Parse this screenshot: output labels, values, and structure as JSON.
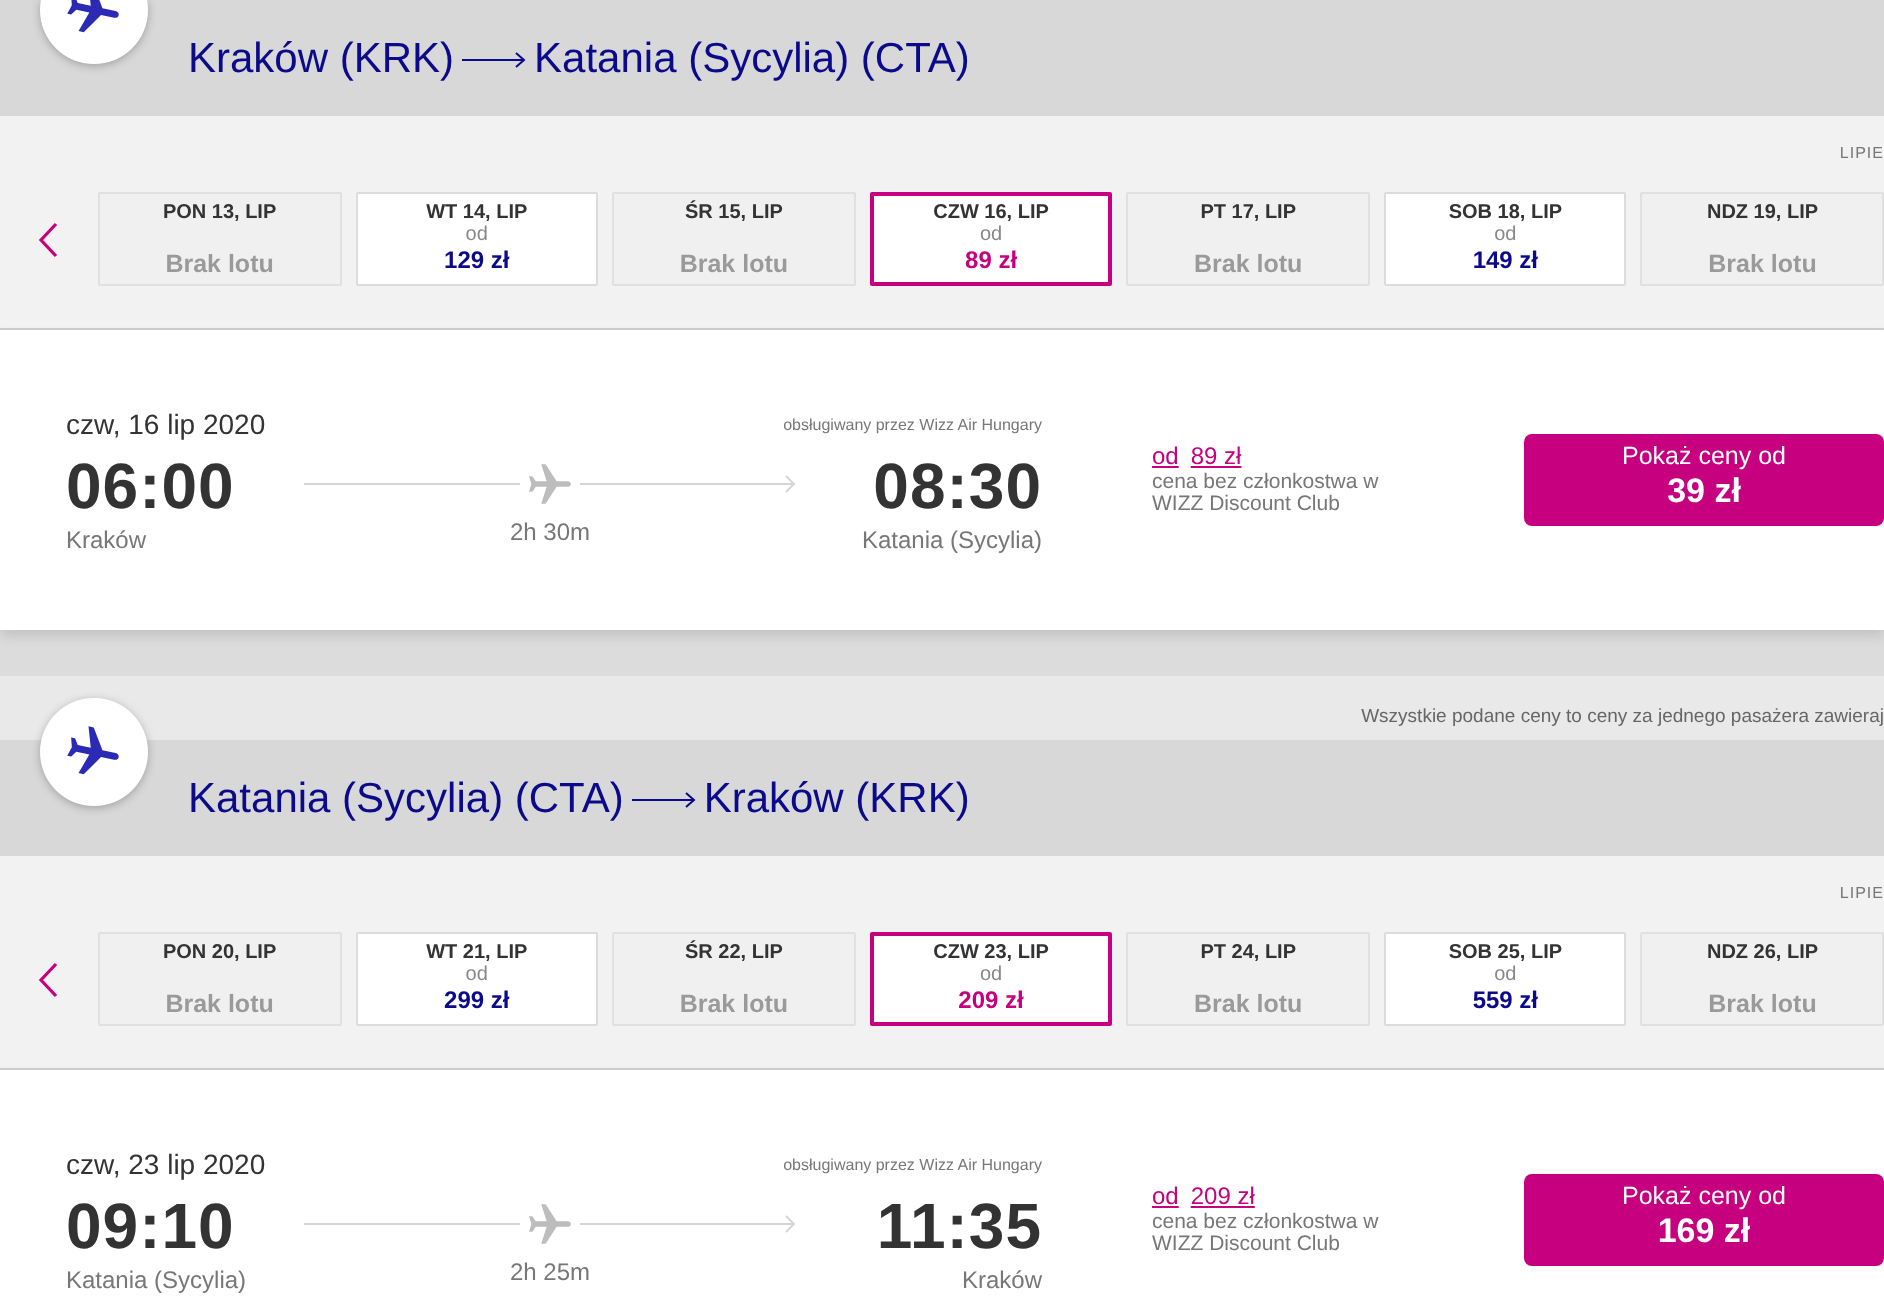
{
  "journeys": [
    {
      "route": {
        "origin": "Kraków (KRK)",
        "destination": "Katania (Sycylia) (CTA)"
      },
      "month_label": "LIPIE",
      "dates": [
        {
          "kind": "no_flight",
          "day": "PON 13, LIP",
          "status": "Brak lotu",
          "selected": false
        },
        {
          "kind": "fare",
          "day": "WT 14, LIP",
          "from": "od",
          "price": "129 zł",
          "selected": false
        },
        {
          "kind": "no_flight",
          "day": "ŚR 15, LIP",
          "status": "Brak lotu",
          "selected": false
        },
        {
          "kind": "fare",
          "day": "CZW 16, LIP",
          "from": "od",
          "price": "89 zł",
          "selected": true
        },
        {
          "kind": "no_flight",
          "day": "PT 17, LIP",
          "status": "Brak lotu",
          "selected": false
        },
        {
          "kind": "fare",
          "day": "SOB 18, LIP",
          "from": "od",
          "price": "149 zł",
          "selected": false
        },
        {
          "kind": "no_flight",
          "day": "NDZ 19, LIP",
          "status": "Brak lotu",
          "selected": false
        }
      ],
      "flight": {
        "date": "czw, 16 lip 2020",
        "operator": "obsługiwany przez Wizz Air Hungary",
        "departure_time": "06:00",
        "departure_city": "Kraków",
        "duration": "2h 30m",
        "arrival_time": "08:30",
        "arrival_city": "Katania (Sycylia)",
        "fare_from": "od",
        "fare_price": "89 zł",
        "fare_note": "cena bez członkostwa w WIZZ Discount Club",
        "button_label": "Pokaż ceny od",
        "button_price": "39 zł"
      }
    },
    {
      "notice": "Wszystkie podane ceny to ceny za jednego pasażera zawieraj",
      "route": {
        "origin": "Katania (Sycylia) (CTA)",
        "destination": "Kraków (KRK)"
      },
      "month_label": "LIPIE",
      "dates": [
        {
          "kind": "no_flight",
          "day": "PON 20, LIP",
          "status": "Brak lotu",
          "selected": false
        },
        {
          "kind": "fare",
          "day": "WT 21, LIP",
          "from": "od",
          "price": "299 zł",
          "selected": false
        },
        {
          "kind": "no_flight",
          "day": "ŚR 22, LIP",
          "status": "Brak lotu",
          "selected": false
        },
        {
          "kind": "fare",
          "day": "CZW 23, LIP",
          "from": "od",
          "price": "209 zł",
          "selected": true
        },
        {
          "kind": "no_flight",
          "day": "PT 24, LIP",
          "status": "Brak lotu",
          "selected": false
        },
        {
          "kind": "fare",
          "day": "SOB 25, LIP",
          "from": "od",
          "price": "559 zł",
          "selected": false
        },
        {
          "kind": "no_flight",
          "day": "NDZ 26, LIP",
          "status": "Brak lotu",
          "selected": false
        }
      ],
      "flight": {
        "date": "czw, 23 lip 2020",
        "operator": "obsługiwany przez Wizz Air Hungary",
        "departure_time": "09:10",
        "departure_city": "Katania (Sycylia)",
        "duration": "2h 25m",
        "arrival_time": "11:35",
        "arrival_city": "Kraków",
        "fare_from": "od",
        "fare_price": "209 zł",
        "fare_note": "cena bez członkostwa w WIZZ Discount Club",
        "button_label": "Pokaż ceny od",
        "button_price": "169 zł"
      }
    }
  ]
}
